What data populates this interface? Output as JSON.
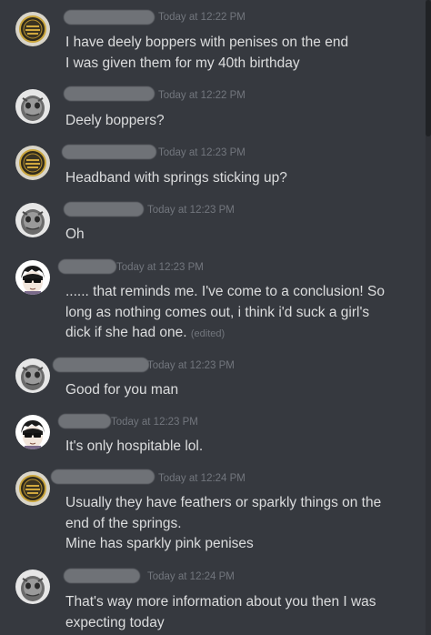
{
  "messages": [
    {
      "avatar": "gold-badge",
      "timestamp": "Today at 12:22 PM",
      "lines": [
        "I have deely boppers with penises on the end",
        "I was given them for my 40th birthday"
      ]
    },
    {
      "avatar": "grey-creature",
      "timestamp": "Today at 12:22 PM",
      "lines": [
        "Deely boppers?"
      ]
    },
    {
      "avatar": "gold-badge",
      "timestamp": "Today at 12:23 PM",
      "lines": [
        "Headband with springs sticking up?"
      ]
    },
    {
      "avatar": "grey-creature",
      "timestamp": "Today at 12:23 PM",
      "lines": [
        "Oh"
      ]
    },
    {
      "avatar": "anime-sunglasses",
      "timestamp": "Today at 12:23 PM",
      "lines": [
        "...... that reminds me. I've come to a conclusion! So",
        "long as nothing comes out, i think i'd suck a girl's",
        "dick if she had one."
      ],
      "edited": "(edited)"
    },
    {
      "avatar": "grey-creature",
      "timestamp": "Today at 12:23 PM",
      "lines": [
        "Good for you man"
      ]
    },
    {
      "avatar": "anime-sunglasses",
      "timestamp": "Today at 12:23 PM",
      "lines": [
        "It's only hospitable lol."
      ]
    },
    {
      "avatar": "gold-badge",
      "timestamp": "Today at 12:24 PM",
      "lines": [
        "Usually they have feathers or sparkly things on the",
        "end of the springs.",
        "Mine has sparkly pink penises"
      ]
    },
    {
      "avatar": "grey-creature",
      "timestamp": "Today at 12:24 PM",
      "lines": [
        "That's way more information about you then I was",
        "expecting today"
      ]
    }
  ],
  "colors": {
    "background": "#36393f",
    "text": "#dcddde",
    "muted": "#72767d",
    "redaction": "#6f7277"
  }
}
